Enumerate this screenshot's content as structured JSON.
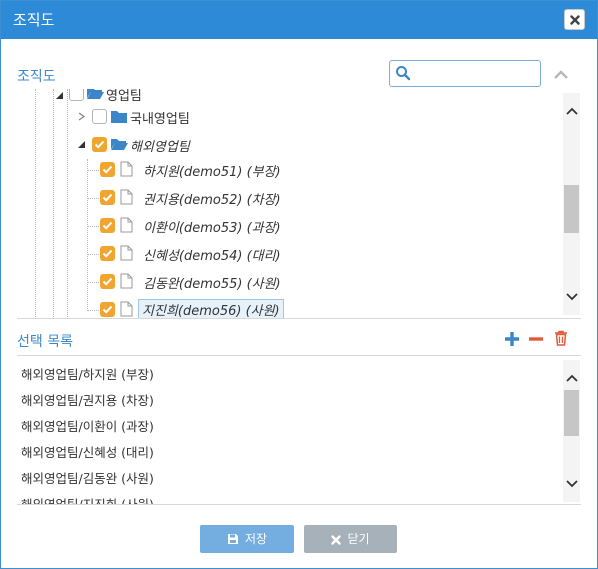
{
  "dialog": {
    "title": "조직도",
    "close_icon": "close-icon"
  },
  "org_section": {
    "label": "조직도",
    "search_placeholder": "",
    "search_value": ""
  },
  "tree": {
    "nodes": [
      {
        "label": "영업팀",
        "checked": false,
        "icon": "folder-open-icon"
      },
      {
        "label": "국내영업팀",
        "checked": false,
        "icon": "folder-icon"
      },
      {
        "label": "해외영업팀",
        "checked": true,
        "icon": "folder-open-icon"
      },
      {
        "label": "하지원(demo51) (부장)",
        "checked": true,
        "icon": "document-icon"
      },
      {
        "label": "권지용(demo52) (차장)",
        "checked": true,
        "icon": "document-icon"
      },
      {
        "label": "이환이(demo53) (과장)",
        "checked": true,
        "icon": "document-icon"
      },
      {
        "label": "신혜성(demo54) (대리)",
        "checked": true,
        "icon": "document-icon"
      },
      {
        "label": "김동완(demo55) (사원)",
        "checked": true,
        "icon": "document-icon"
      },
      {
        "label": "지진희(demo56) (사원)",
        "checked": true,
        "icon": "document-icon",
        "selected": true
      }
    ]
  },
  "selection_section": {
    "label": "선택 목록",
    "items": [
      "해외영업팀/하지원 (부장)",
      "해외영업팀/권지용 (차장)",
      "해외영업팀/이환이 (과장)",
      "해외영업팀/신혜성 (대리)",
      "해외영업팀/김동완 (사원)",
      "해외영업팀/지진희 (사원)"
    ]
  },
  "buttons": {
    "save_label": "저장",
    "close_label": "닫기"
  },
  "colors": {
    "titlebar": "#2d8ad6",
    "accent": "#3e88c8",
    "checkbox": "#f0a530",
    "folder": "#3b86c8",
    "delete": "#e05a3a"
  }
}
